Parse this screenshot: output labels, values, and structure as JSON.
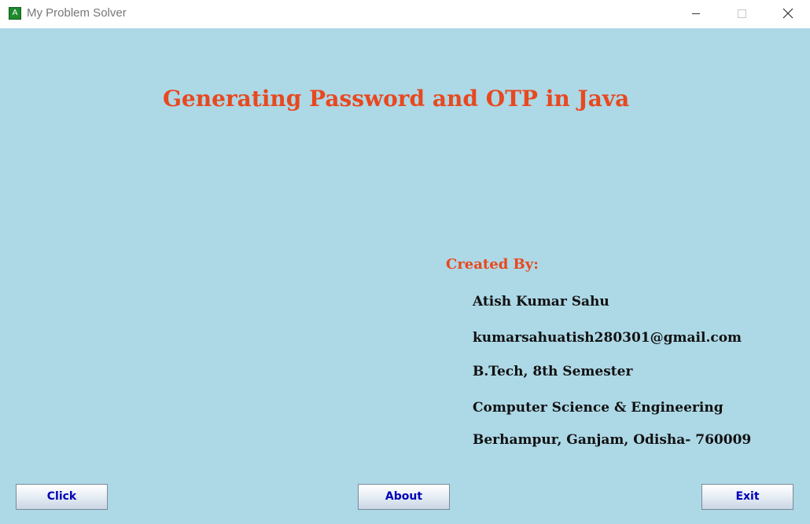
{
  "window": {
    "title": "My Problem Solver",
    "icon_letter": "A"
  },
  "main": {
    "heading": "Generating Password and OTP in Java",
    "created_by_label": "Created By:",
    "author": {
      "name": "Atish Kumar Sahu",
      "email": "kumarsahuatish280301@gmail.com",
      "degree": "B.Tech, 8th Semester",
      "department": "Computer Science & Engineering",
      "address": "Berhampur, Ganjam, Odisha- 760009"
    }
  },
  "buttons": {
    "click": "Click",
    "about": "About",
    "exit": "Exit"
  },
  "colors": {
    "background": "#ADD8E6",
    "heading": "#E8481F",
    "button_text": "#0000B8"
  }
}
